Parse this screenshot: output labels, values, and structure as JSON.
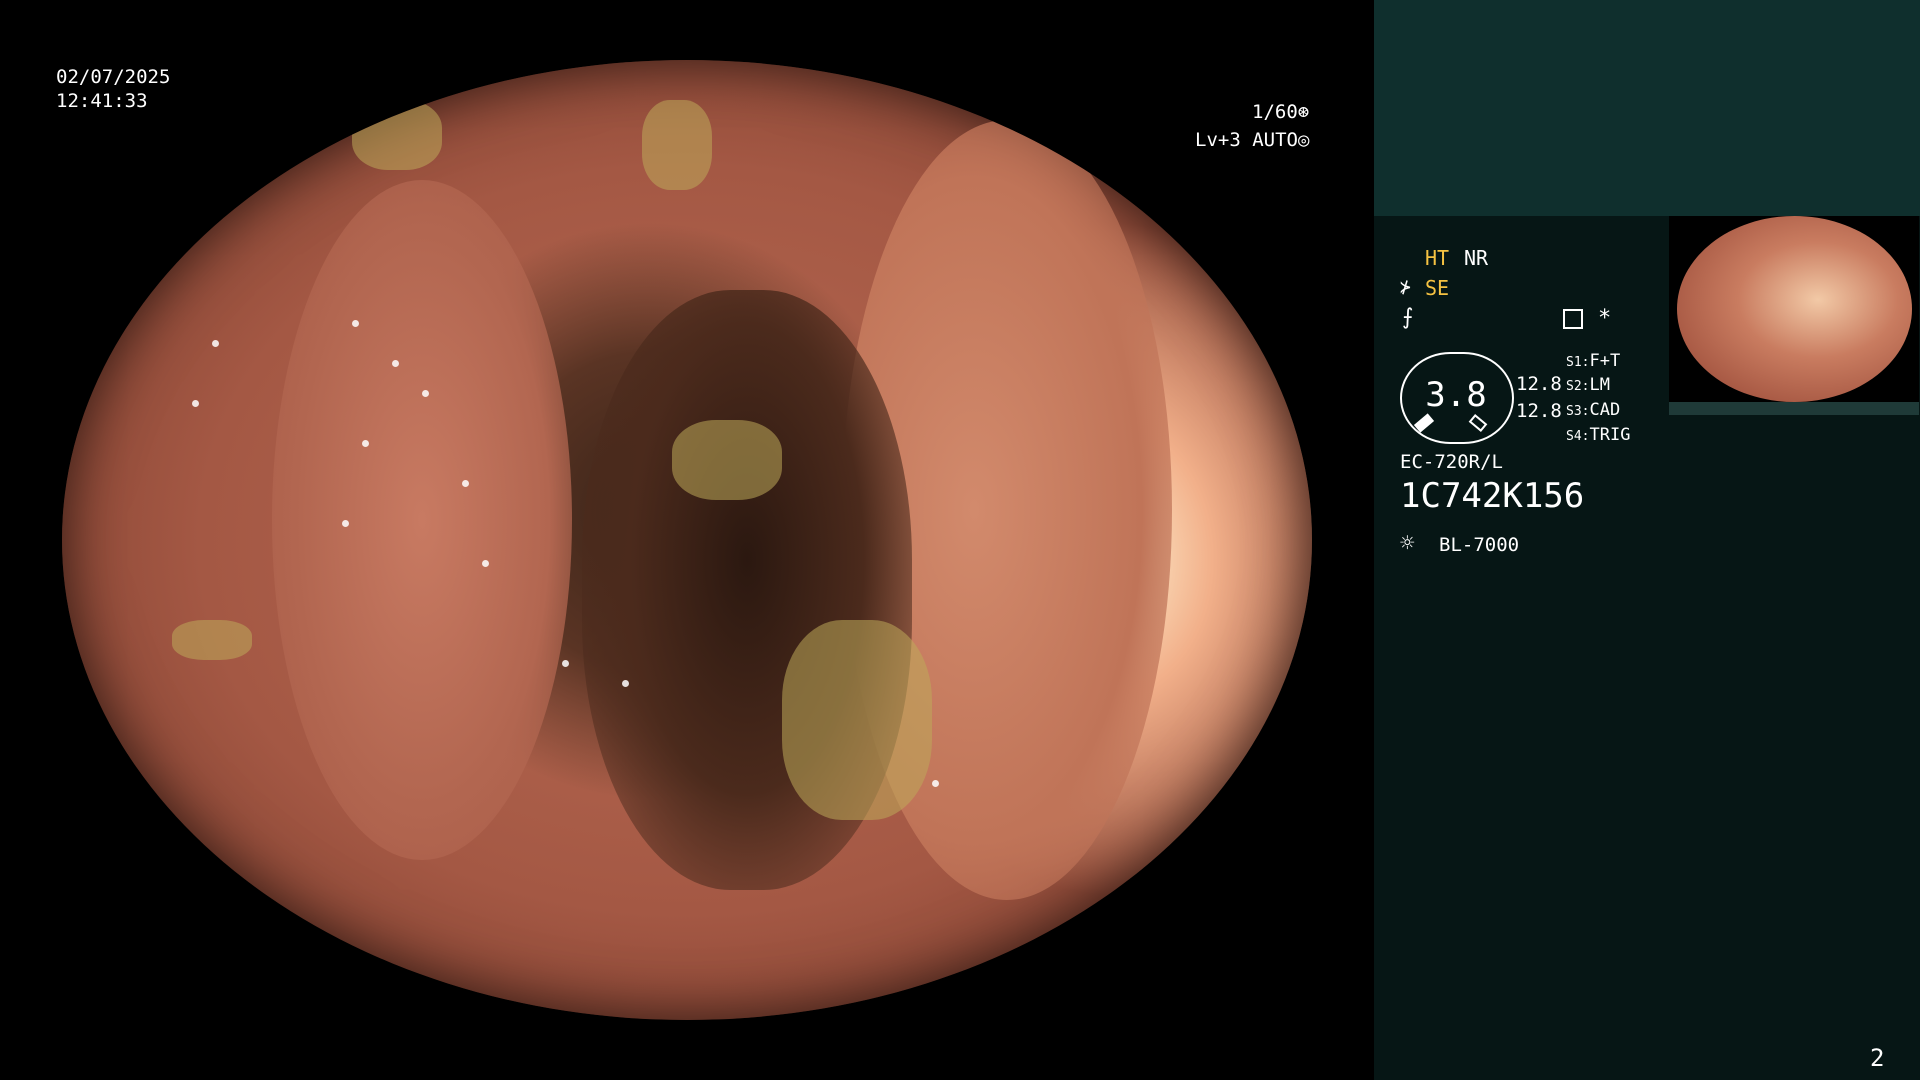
{
  "overlay": {
    "date": "02/07/2025",
    "time": "12:41:33",
    "shutter": "1/60",
    "shutter_icon": "⊛",
    "level": "Lv+3 AUTO",
    "level_icon": "◎"
  },
  "panel": {
    "ht": "HT",
    "nr": "NR",
    "se_icon": "⊁",
    "se": "SE",
    "ce_icon": "⨍",
    "star": "*",
    "gauge_value": "3.8",
    "gauge_values": [
      "12.8",
      "12.8"
    ],
    "scope_settings": [
      {
        "key": "S1:",
        "value": "F+T"
      },
      {
        "key": "S2:",
        "value": "LM"
      },
      {
        "key": "S3:",
        "value": "CAD"
      },
      {
        "key": "S4:",
        "value": "TRIG"
      }
    ],
    "scope_model": "EC-720R/L",
    "serial": "1C742K156",
    "light_icon": "☼",
    "light_source": "BL-7000"
  },
  "page_number": "2",
  "colors": {
    "panel_top": "#0f2f2d",
    "panel": "#061615",
    "highlight_yellow": "#f5c242"
  }
}
